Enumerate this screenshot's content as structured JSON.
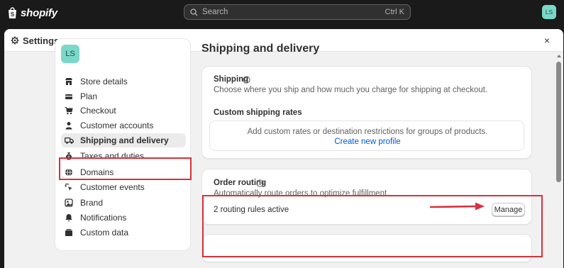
{
  "topbar": {
    "logo_text": "shopify",
    "search_placeholder": "Search",
    "search_shortcut": "Ctrl K",
    "user_initials": "LS"
  },
  "modal": {
    "title": "Settings",
    "close_label": "×"
  },
  "sidebar": {
    "avatar_initials": "LS",
    "items": [
      {
        "label": "Store details",
        "icon": "store-icon"
      },
      {
        "label": "Plan",
        "icon": "plan-icon"
      },
      {
        "label": "Checkout",
        "icon": "cart-icon"
      },
      {
        "label": "Customer accounts",
        "icon": "person-icon"
      },
      {
        "label": "Shipping and delivery",
        "icon": "truck-icon",
        "active": true
      },
      {
        "label": "Taxes and duties",
        "icon": "tax-icon"
      },
      {
        "label": "Domains",
        "icon": "globe-icon"
      },
      {
        "label": "Customer events",
        "icon": "events-icon"
      },
      {
        "label": "Brand",
        "icon": "brand-icon"
      },
      {
        "label": "Notifications",
        "icon": "bell-icon"
      },
      {
        "label": "Custom data",
        "icon": "data-icon"
      }
    ]
  },
  "main": {
    "page_title": "Shipping and delivery",
    "shipping_card": {
      "title": "Shipping",
      "description": "Choose where you ship and how much you charge for shipping at checkout.",
      "custom_rates_title": "Custom shipping rates",
      "custom_rates_text": "Add custom rates or destination restrictions for groups of products.",
      "create_profile_link": "Create new profile"
    },
    "order_routing_card": {
      "title": "Order routing",
      "description": "Automatically route orders to optimize fulfillment.",
      "status": "2 routing rules active",
      "manage_label": "Manage"
    }
  },
  "colors": {
    "accent_link": "#005bd3",
    "highlight": "#d9313b",
    "avatar_bg": "#7ad8c8"
  }
}
